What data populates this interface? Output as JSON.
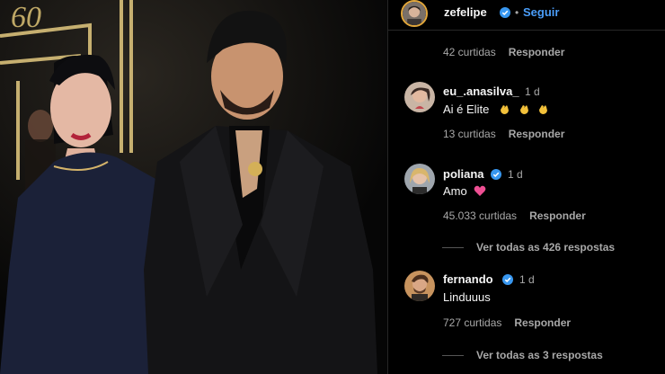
{
  "photo": {
    "sign_text": "60"
  },
  "post": {
    "author": "zefelipe",
    "follow_label": "Seguir",
    "separator": "•",
    "top_meta": {
      "likes": "42 curtidas",
      "reply_label": "Responder"
    }
  },
  "comments": [
    {
      "username": "eu_.anasilva_",
      "time": "1 d",
      "text": "Ai é Elite",
      "likes": "13 curtidas",
      "reply_label": "Responder",
      "emoji": [
        "clapping-hands",
        "clapping-hands",
        "clapping-hands"
      ]
    },
    {
      "username": "poliana",
      "time": "1 d",
      "text": "Amo",
      "likes": "45.033 curtidas",
      "reply_label": "Responder",
      "emoji": [
        "pink-heart"
      ],
      "view_replies": "Ver todas as 426 respostas"
    },
    {
      "username": "fernando",
      "time": "1 d",
      "text": "Linduuus",
      "likes": "727 curtidas",
      "reply_label": "Responder",
      "view_replies": "Ver todas as 3 respostas"
    }
  ],
  "colors": {
    "link_blue": "#4a9df8",
    "verified_blue": "#3897f0",
    "muted": "#a8a8a8",
    "dress": "#1b2138",
    "suit": "#141416"
  }
}
